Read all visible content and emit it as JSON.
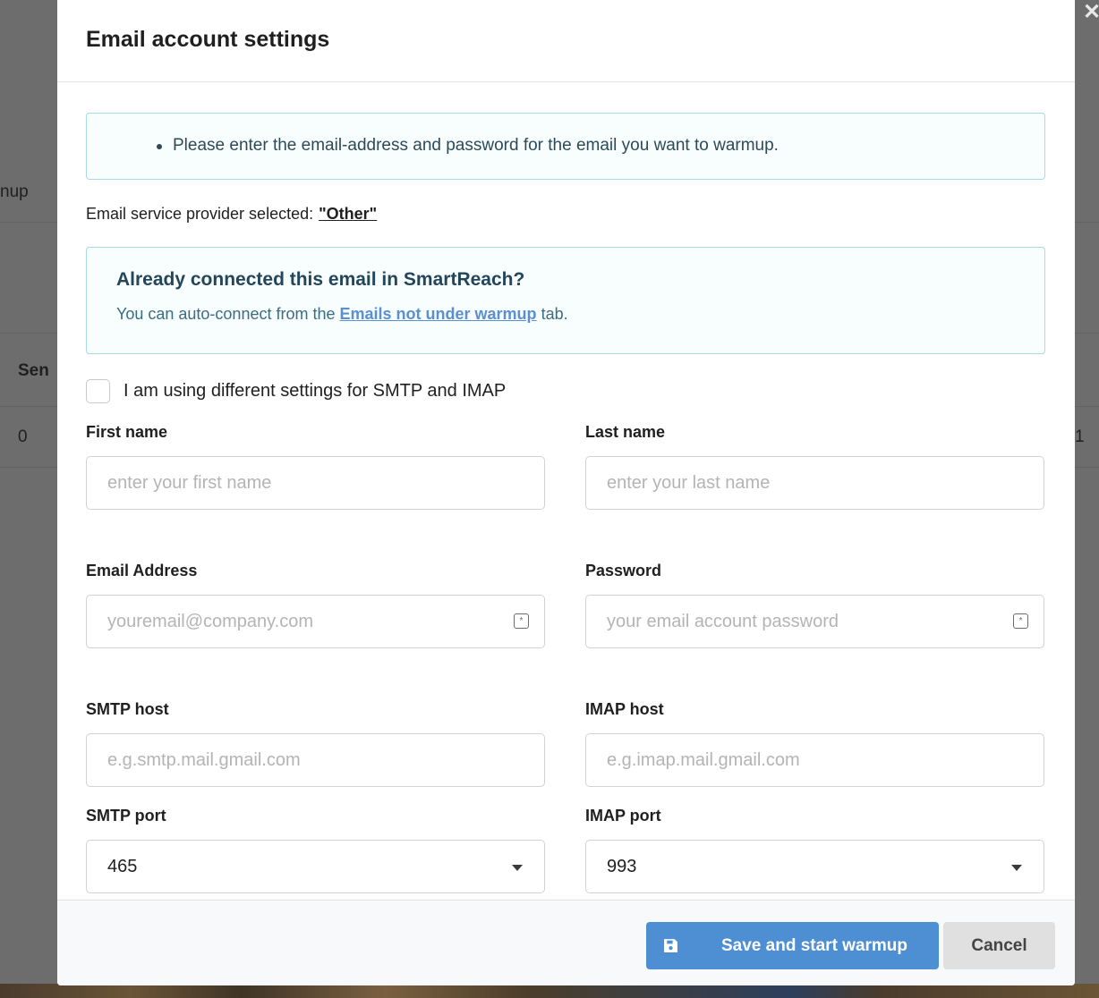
{
  "background": {
    "partial_tab": "nup",
    "partial_header": "Sen",
    "partial_cell": "0",
    "partial_right_cell": "1",
    "close_glyph": "✕"
  },
  "modal": {
    "title": "Email account settings",
    "info_text": "Please enter the email-address and password for the email you want to warmup.",
    "provider_prefix": "Email service provider selected:",
    "provider_value": "\"Other\"",
    "connected": {
      "title": "Already connected this email in SmartReach?",
      "desc_prefix": "You can auto-connect from the",
      "link_text": "Emails not under warmup",
      "desc_suffix": "tab."
    },
    "checkbox_label": "I am using different settings for SMTP and IMAP",
    "fields": {
      "first_name": {
        "label": "First name",
        "placeholder": "enter your first name"
      },
      "last_name": {
        "label": "Last name",
        "placeholder": "enter your last name"
      },
      "email": {
        "label": "Email Address",
        "placeholder": "youremail@company.com"
      },
      "password": {
        "label": "Password",
        "placeholder": "your email account password"
      },
      "smtp_host": {
        "label": "SMTP host",
        "placeholder": "e.g.smtp.mail.gmail.com"
      },
      "imap_host": {
        "label": "IMAP host",
        "placeholder": "e.g.imap.mail.gmail.com"
      },
      "smtp_port": {
        "label": "SMTP port",
        "value": "465"
      },
      "imap_port": {
        "label": "IMAP port",
        "value": "993"
      }
    },
    "footer": {
      "save_label": "Save and start warmup",
      "cancel_label": "Cancel"
    }
  },
  "colors": {
    "primary": "#4e8fd4",
    "info_border": "#a9dbe3",
    "overlay": "#6d6d6d"
  }
}
